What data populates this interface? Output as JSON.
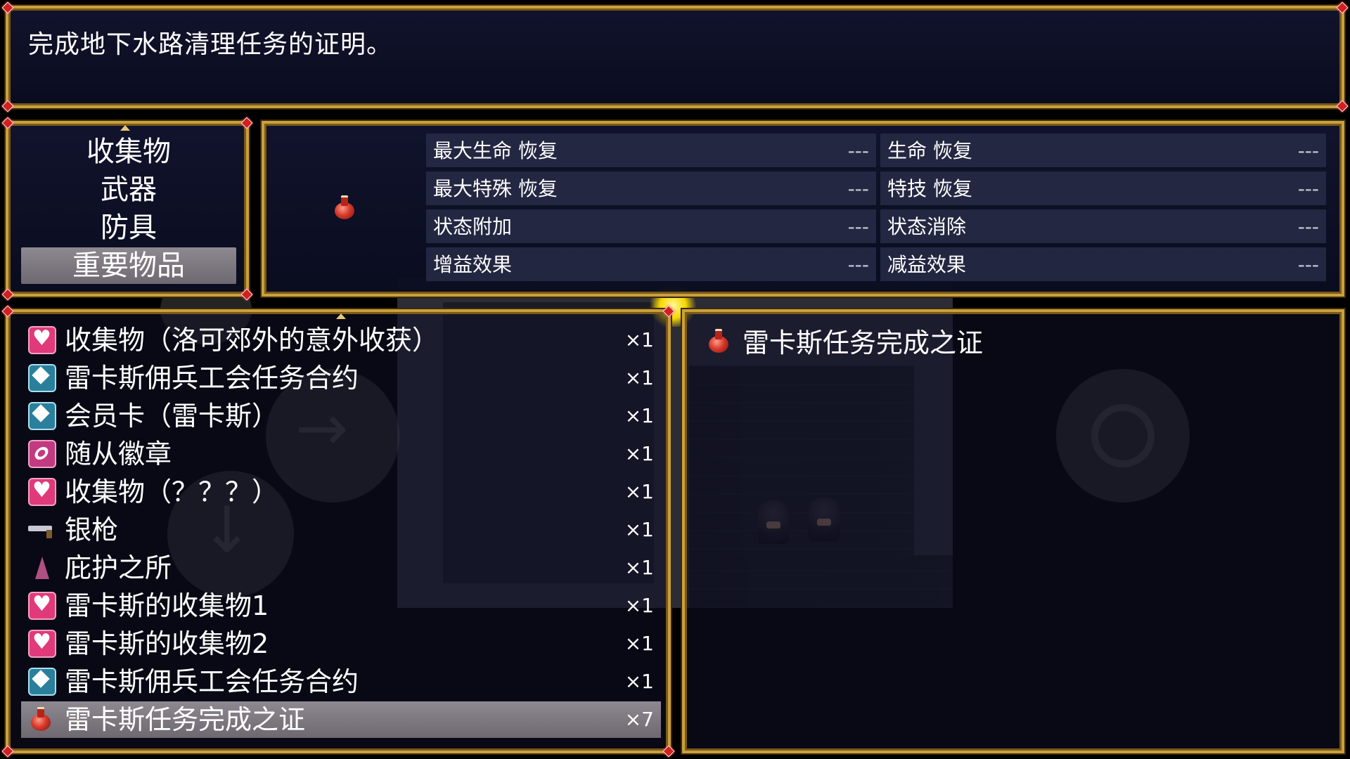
{
  "help": {
    "text": "完成地下水路清理任务的证明。"
  },
  "categories": [
    {
      "label": "收集物",
      "selected": false
    },
    {
      "label": "武器",
      "selected": false
    },
    {
      "label": "防具",
      "selected": false
    },
    {
      "label": "重要物品",
      "selected": true
    }
  ],
  "status": {
    "rows": [
      {
        "left_label": "最大生命 恢复",
        "left_value": "---",
        "right_label": "生命 恢复",
        "right_value": "---"
      },
      {
        "left_label": "最大特殊 恢复",
        "left_value": "---",
        "right_label": "特技 恢复",
        "right_value": "---"
      },
      {
        "left_label": "状态附加",
        "left_value": "---",
        "right_label": "状态消除",
        "right_value": "---"
      },
      {
        "left_label": "增益效果",
        "left_value": "---",
        "right_label": "减益效果",
        "right_value": "---"
      }
    ],
    "icon": "potion-icon"
  },
  "items": [
    {
      "name": "收集物（洛可郊外的意外收获）",
      "qty": "×1",
      "icon": "heart-icon",
      "selected": false
    },
    {
      "name": "雷卡斯佣兵工会任务合约",
      "qty": "×1",
      "icon": "card-icon",
      "selected": false
    },
    {
      "name": "会员卡（雷卡斯）",
      "qty": "×1",
      "icon": "card-icon",
      "selected": false
    },
    {
      "name": "随从徽章",
      "qty": "×1",
      "icon": "badge-icon",
      "selected": false
    },
    {
      "name": "收集物（？？？）",
      "qty": "×1",
      "icon": "heart-icon",
      "selected": false
    },
    {
      "name": "银枪",
      "qty": "×1",
      "icon": "gun-icon",
      "selected": false
    },
    {
      "name": "庇护之所",
      "qty": "×1",
      "icon": "cloak-icon",
      "selected": false
    },
    {
      "name": "雷卡斯的收集物1",
      "qty": "×1",
      "icon": "heart-icon",
      "selected": false
    },
    {
      "name": "雷卡斯的收集物2",
      "qty": "×1",
      "icon": "heart-icon",
      "selected": false
    },
    {
      "name": "雷卡斯佣兵工会任务合约",
      "qty": "×1",
      "icon": "card-icon",
      "selected": false
    },
    {
      "name": "雷卡斯任务完成之证",
      "qty": "×7",
      "icon": "potion-icon",
      "selected": true
    }
  ],
  "detail": {
    "name": "雷卡斯任务完成之证",
    "icon": "potion-icon"
  },
  "colors": {
    "frame": "#c9a03d",
    "window_bg": "#12142e",
    "selection": "#7e7880",
    "corner_gem": "#d02020"
  }
}
